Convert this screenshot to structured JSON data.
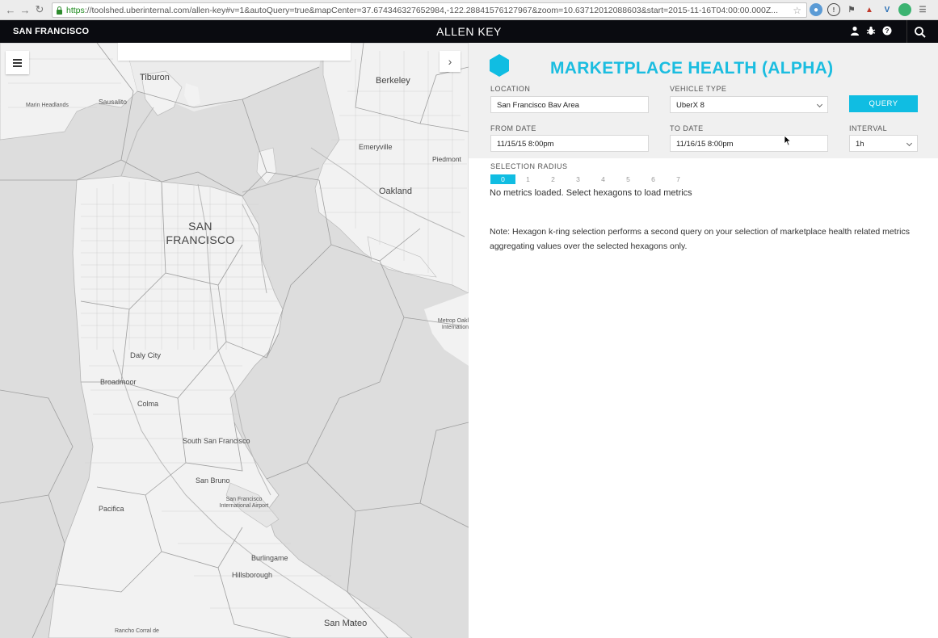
{
  "browser": {
    "url_https": "https",
    "url_rest": "://toolshed.uberinternal.com/allen-key#v=1&autoQuery=true&mapCenter=37.674346327652984,-122.28841576127967&zoom=10.63712012088603&start=2015-11-16T04:00:00.000Z..."
  },
  "header": {
    "city": "SAN FRANCISCO",
    "title": "ALLEN KEY"
  },
  "map": {
    "labels": {
      "tiburon": "Tiburon",
      "marin_headlands": "Marin Headlands",
      "sausalito": "Sausalito",
      "berkeley": "Berkeley",
      "emeryville": "Emeryville",
      "piedmont": "Piedmont",
      "oakland": "Oakland",
      "san_francisco": "SAN FRANCISCO",
      "daly_city": "Daly City",
      "broadmoor": "Broadmoor",
      "colma": "Colma",
      "south_sf": "South San Francisco",
      "san_bruno": "San Bruno",
      "sfo": "San Francisco International Airport",
      "pacifica": "Pacifica",
      "burlingame": "Burlingame",
      "hillsborough": "Hillsborough",
      "san_mateo": "San Mateo",
      "rancho": "Rancho Corral de",
      "metro_oak": "Metrop Oakl Internation"
    }
  },
  "panel": {
    "title": "MARKETPLACE HEALTH (ALPHA)",
    "location": {
      "label": "LOCATION",
      "value": "San Francisco Bav Area"
    },
    "vehicle_type": {
      "label": "VEHICLE TYPE",
      "value": "UberX 8"
    },
    "query_label": "QUERY",
    "from_date": {
      "label": "FROM DATE",
      "value": "11/15/15 8:00pm"
    },
    "to_date": {
      "label": "TO DATE",
      "value": "11/16/15 8:00pm"
    },
    "interval": {
      "label": "INTERVAL",
      "value": "1h"
    },
    "selection_radius": {
      "label": "SELECTION RADIUS",
      "options": [
        "0",
        "1",
        "2",
        "3",
        "4",
        "5",
        "6",
        "7"
      ],
      "selected": "0"
    },
    "status": "No metrics loaded. Select hexagons to load metrics",
    "note": "Note: Hexagon k-ring selection performs a second query on your selection of marketplace health related metrics aggregating values over the selected hexagons only."
  },
  "colors": {
    "accent": "#10bde2",
    "header_bg": "#0a0b10",
    "map_land": "#f2f2f2",
    "map_water": "#dddddd"
  }
}
